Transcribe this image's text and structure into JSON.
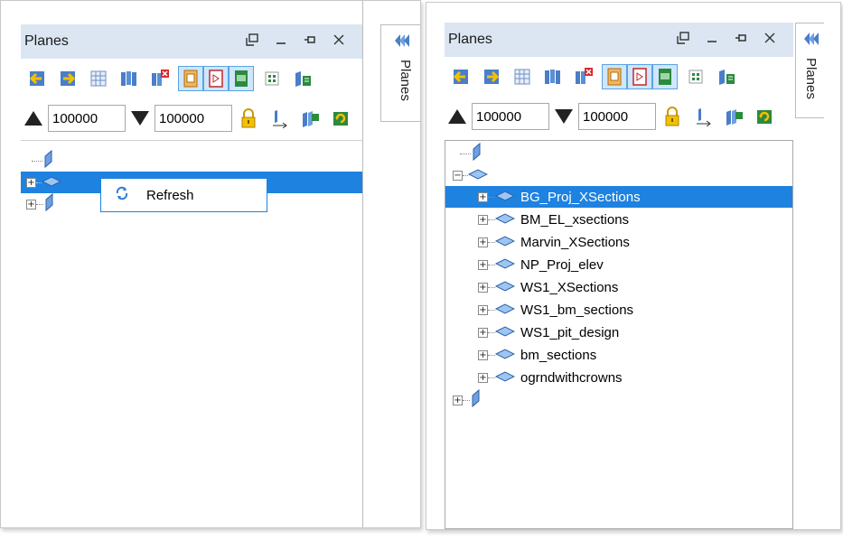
{
  "left": {
    "title": "Planes",
    "side_tab": "Planes",
    "upper": "100000",
    "lower": "100000",
    "context_menu": {
      "refresh_label": "Refresh"
    }
  },
  "right": {
    "title": "Planes",
    "side_tab": "Planes",
    "upper": "100000",
    "lower": "100000",
    "items": [
      "BG_Proj_XSections",
      "BM_EL_xsections",
      "Marvin_XSections",
      "NP_Proj_elev",
      "WS1_XSections",
      "WS1_bm_sections",
      "WS1_pit_design",
      "bm_sections",
      "ogrndwithcrowns"
    ],
    "selected_index": 0
  },
  "colors": {
    "selection": "#1e82e0",
    "titlebar": "#dbe6f2",
    "toggle": "#cfe6fb"
  }
}
